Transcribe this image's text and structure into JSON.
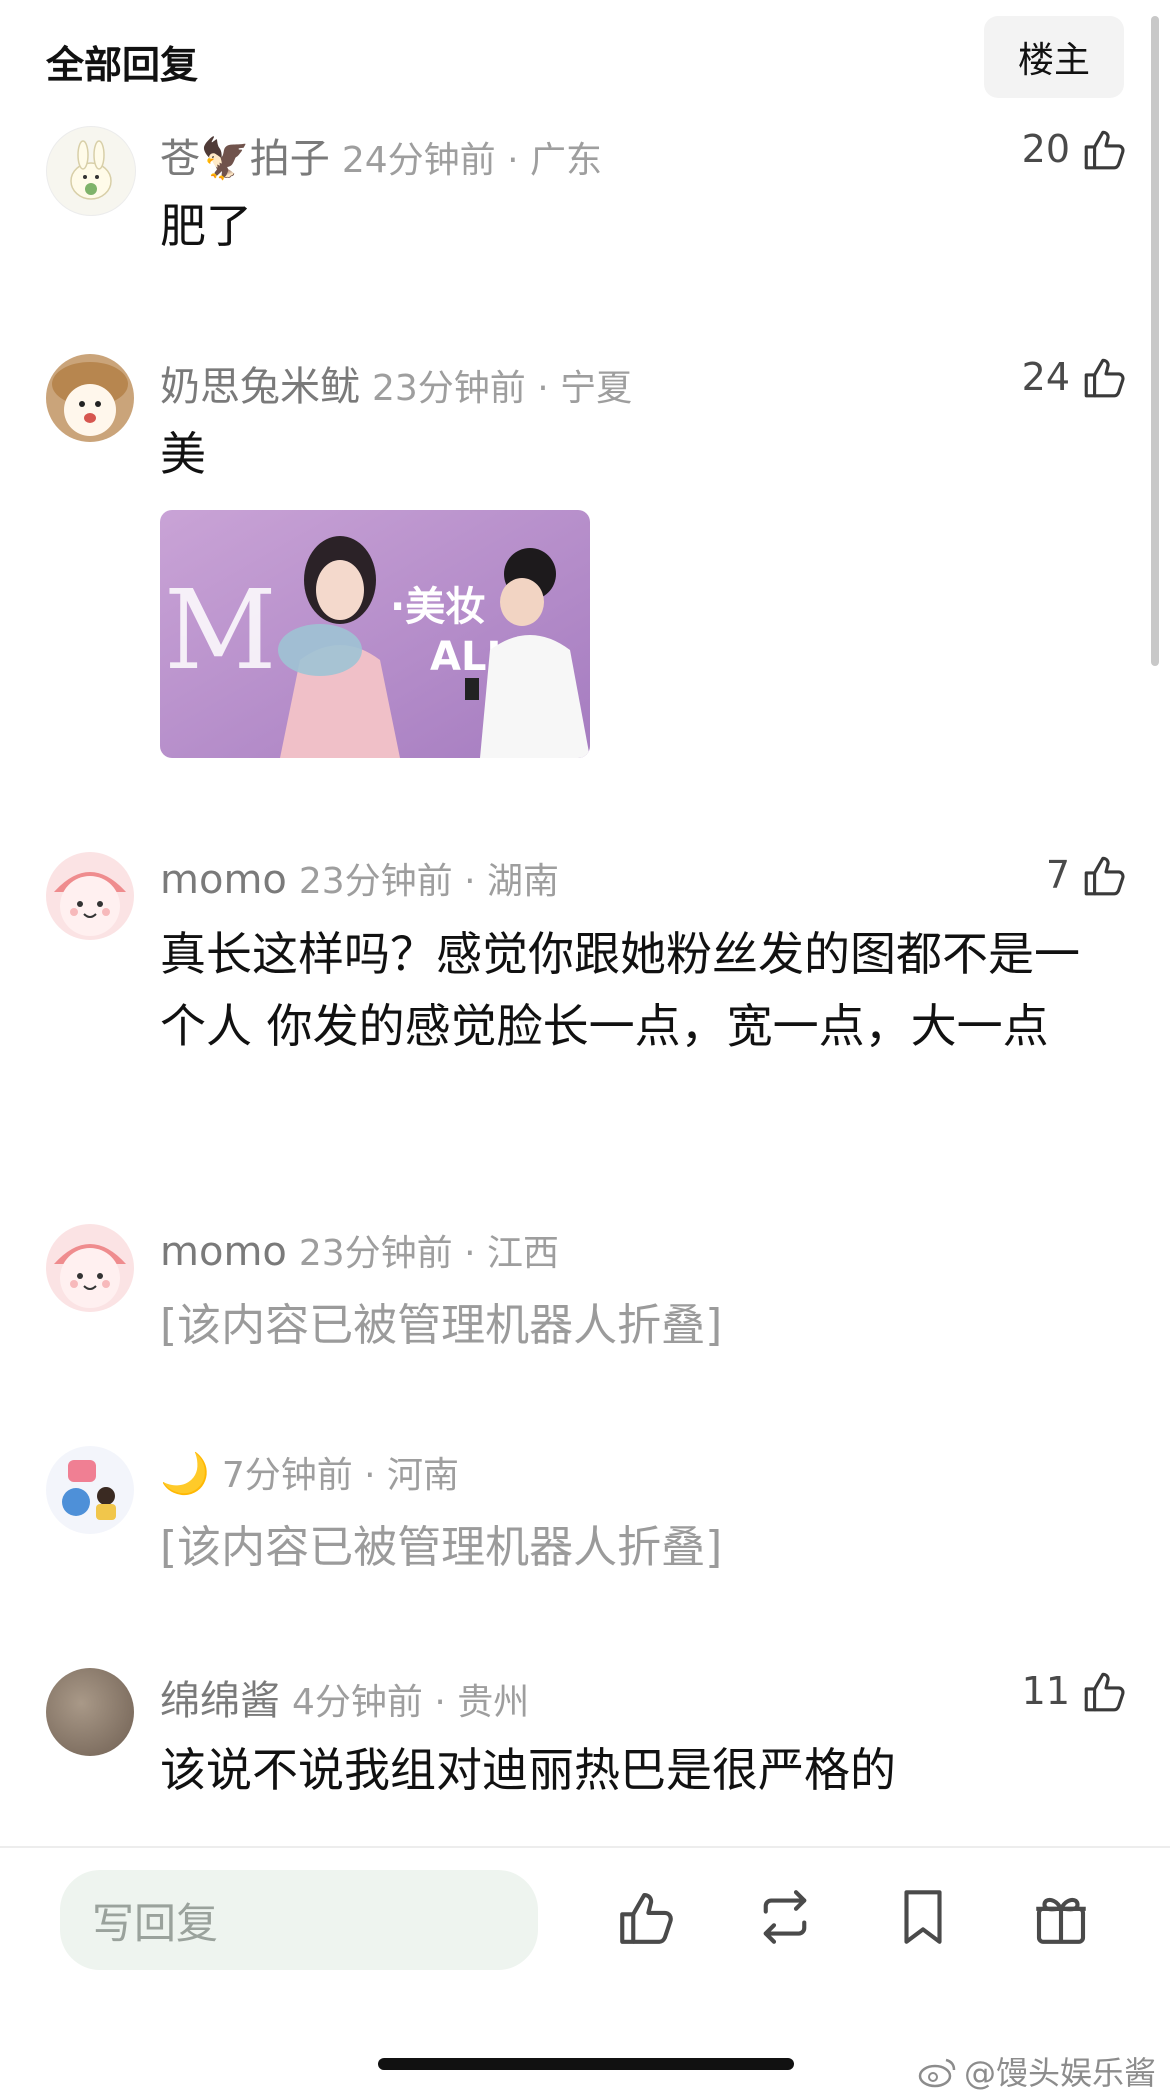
{
  "header": {
    "title": "全部回复",
    "op_label": "楼主"
  },
  "comments": [
    {
      "user": "苍🦅拍子",
      "meta": "24分钟前 · 广东",
      "text": "肥了",
      "likes": "20"
    },
    {
      "user": "奶思兔米鱿",
      "meta": "23分钟前 · 宁夏",
      "text": "美",
      "likes": "24"
    },
    {
      "user": "momo",
      "meta": "23分钟前 · 湖南",
      "text": "真长这样吗？感觉你跟她粉丝发的图都不是一个人 你发的感觉脸长一点，宽一点，大一点",
      "likes": "7"
    },
    {
      "user": "momo",
      "meta": "23分钟前 · 江西",
      "text": "[该内容已被管理机器人折叠]"
    },
    {
      "user": "🌙",
      "meta": "7分钟前 · 河南",
      "text": "[该内容已被管理机器人折叠]"
    },
    {
      "user": "绵绵酱",
      "meta": "4分钟前 · 贵州",
      "text": "该说不说我组对迪丽热巴是很严格的",
      "likes": "11"
    }
  ],
  "photo": {
    "banner_text": "M · 美妆 ALL"
  },
  "bottom_bar": {
    "reply_placeholder": "写回复"
  },
  "watermark": "@馒头娱乐酱",
  "colors": {
    "meta": "#9e9e9e",
    "folded": "#9b9b9b",
    "reply_bg": "#eef4ef"
  }
}
